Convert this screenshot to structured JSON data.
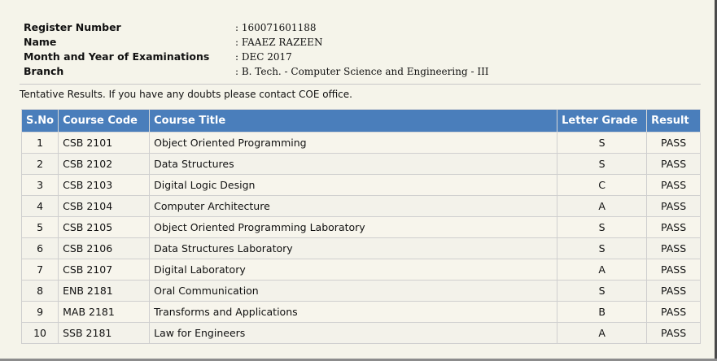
{
  "student": {
    "register_label": "Register Number",
    "register_value": ": 160071601188",
    "name_label": "Name",
    "name_value": ": FAAEZ RAZEEN",
    "exam_label": "Month and Year of Examinations",
    "exam_value": ": DEC 2017",
    "branch_label": "Branch",
    "branch_value": ": B. Tech. - Computer Science and Engineering - III"
  },
  "note": "Tentative Results. If you have any doubts please contact COE office.",
  "table": {
    "headers": [
      "S.No",
      "Course Code",
      "Course Title",
      "Letter Grade",
      "Result"
    ],
    "rows": [
      [
        "1",
        "CSB 2101",
        "Object Oriented Programming",
        "S",
        "PASS"
      ],
      [
        "2",
        "CSB 2102",
        "Data Structures",
        "S",
        "PASS"
      ],
      [
        "3",
        "CSB 2103",
        "Digital Logic Design",
        "C",
        "PASS"
      ],
      [
        "4",
        "CSB 2104",
        "Computer Architecture",
        "A",
        "PASS"
      ],
      [
        "5",
        "CSB 2105",
        "Object Oriented Programming Laboratory",
        "S",
        "PASS"
      ],
      [
        "6",
        "CSB 2106",
        "Data Structures Laboratory",
        "S",
        "PASS"
      ],
      [
        "7",
        "CSB 2107",
        "Digital Laboratory",
        "A",
        "PASS"
      ],
      [
        "8",
        "ENB 2181",
        "Oral Communication",
        "S",
        "PASS"
      ],
      [
        "9",
        "MAB 2181",
        "Transforms and Applications",
        "B",
        "PASS"
      ],
      [
        "10",
        "SSB 2181",
        "Law for Engineers",
        "A",
        "PASS"
      ]
    ]
  },
  "colors": {
    "header_bg": "#4a7ebb",
    "page_bg": "#f5f4ea"
  }
}
